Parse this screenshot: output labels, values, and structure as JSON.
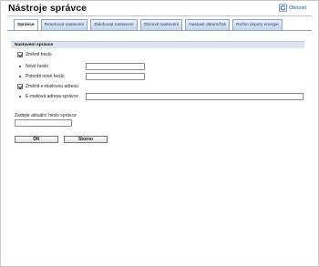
{
  "header": {
    "title": "Nástroje správce",
    "refresh_label": "Obnovit"
  },
  "tabs": [
    {
      "label": "Správce",
      "active": true
    },
    {
      "label": "Resetovat nastavení",
      "active": false
    },
    {
      "label": "Zálohovat nastavení",
      "active": false
    },
    {
      "label": "Obnovit nastavení",
      "active": false
    },
    {
      "label": "Nastavit datum/čas",
      "active": false
    },
    {
      "label": "Režim úspory energie",
      "active": false
    }
  ],
  "section": {
    "title": "Nastavení správce",
    "change_password": {
      "label": "Změnit heslo",
      "checked": true
    },
    "new_password": {
      "label": "Nové heslo",
      "value": ""
    },
    "confirm_password": {
      "label": "Potvrdit nové heslo",
      "value": ""
    },
    "change_email": {
      "label": "Změnit e-mailovou adresu",
      "checked": true
    },
    "admin_email": {
      "label": "E-mailová adresa správce",
      "value": ""
    }
  },
  "current_password": {
    "label": "Zadejte aktuální heslo správce",
    "value": ""
  },
  "buttons": {
    "ok": "OK",
    "cancel": "Storno"
  },
  "colors": {
    "accent": "#1c4e9c",
    "tab_bg": "#c4d3ea",
    "section_bg": "#dde4ef"
  },
  "icons": {
    "refresh": "refresh-icon"
  }
}
